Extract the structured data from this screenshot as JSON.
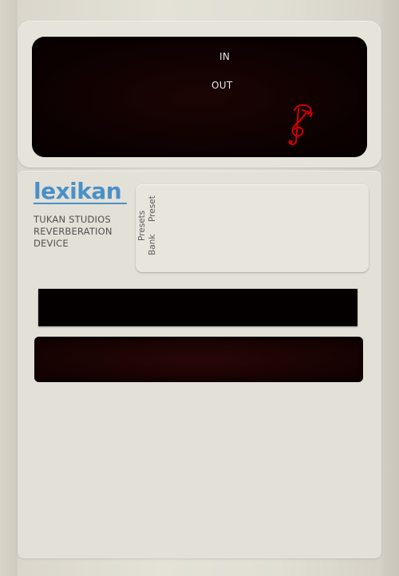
{
  "display": {
    "in_label": "IN",
    "out_label": "OUT"
  },
  "brand": {
    "name": "lexikan",
    "tagline_line1": "TUKAN STUDIOS",
    "tagline_line2": "REVERBERATION",
    "tagline_line3": "DEVICE",
    "color": "#4a90c8"
  },
  "presets": {
    "section_label": "Presets",
    "preset_label": "Preset",
    "bank_label": "Bank"
  },
  "icons": {
    "signal_indicator": "treble-clef-icon"
  },
  "colors": {
    "panel": "#e3e0d7",
    "display": "#0c0101",
    "indicator": "#d10000"
  }
}
